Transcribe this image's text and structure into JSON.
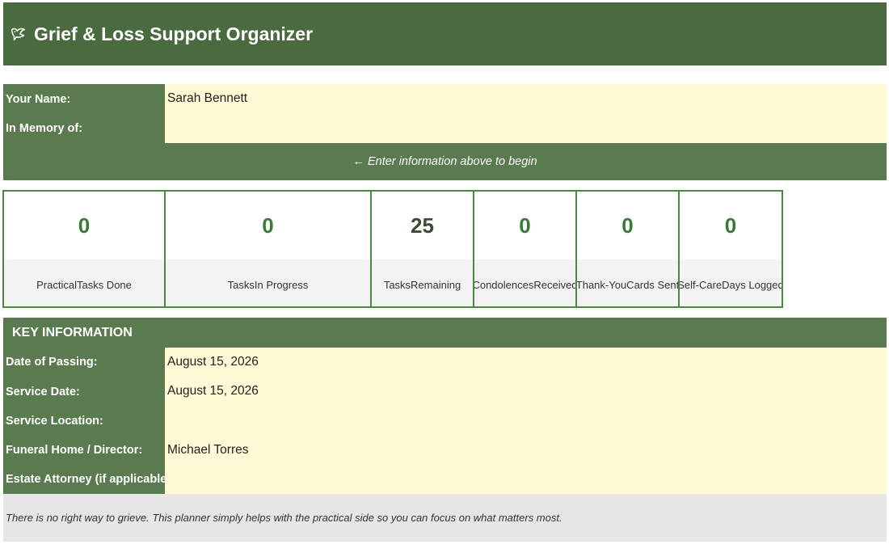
{
  "header": {
    "title": "Grief & Loss Support Organizer",
    "icon": "dove-icon"
  },
  "profile": {
    "name_label": "Your Name:",
    "name_value": "Sarah Bennett",
    "memory_label": "In Memory of:",
    "memory_value": ""
  },
  "hint": {
    "text": "← Enter information above to begin"
  },
  "stats": [
    {
      "value": "0",
      "label": "PracticalTasks Done"
    },
    {
      "value": "0",
      "label": "TasksIn Progress"
    },
    {
      "value": "25",
      "label": "TasksRemaining"
    },
    {
      "value": "0",
      "label": "CondolencesReceived"
    },
    {
      "value": "0",
      "label": "Thank-YouCards Sent"
    },
    {
      "value": "0",
      "label": "Self-CareDays Logged"
    }
  ],
  "key_info": {
    "heading": "KEY INFORMATION",
    "rows": [
      {
        "label": "Date of Passing:",
        "value": "August 15, 2026"
      },
      {
        "label": "Service Date:",
        "value": "August 15, 2026"
      },
      {
        "label": "Service Location:",
        "value": ""
      },
      {
        "label": "Funeral Home / Director:",
        "value": "Michael Torres"
      },
      {
        "label": "Estate Attorney (if applicable):",
        "value": ""
      }
    ]
  },
  "footer": {
    "note": "There is no right way to grieve. This planner simply helps with the practical side so you can focus on what matters most."
  },
  "colors": {
    "header_bg": "#4a6b3f",
    "label_bg": "#5a7a50",
    "input_bg": "#fff9d6",
    "stat_number": "#3b7a36",
    "stat_border": "#4a8a3f"
  }
}
